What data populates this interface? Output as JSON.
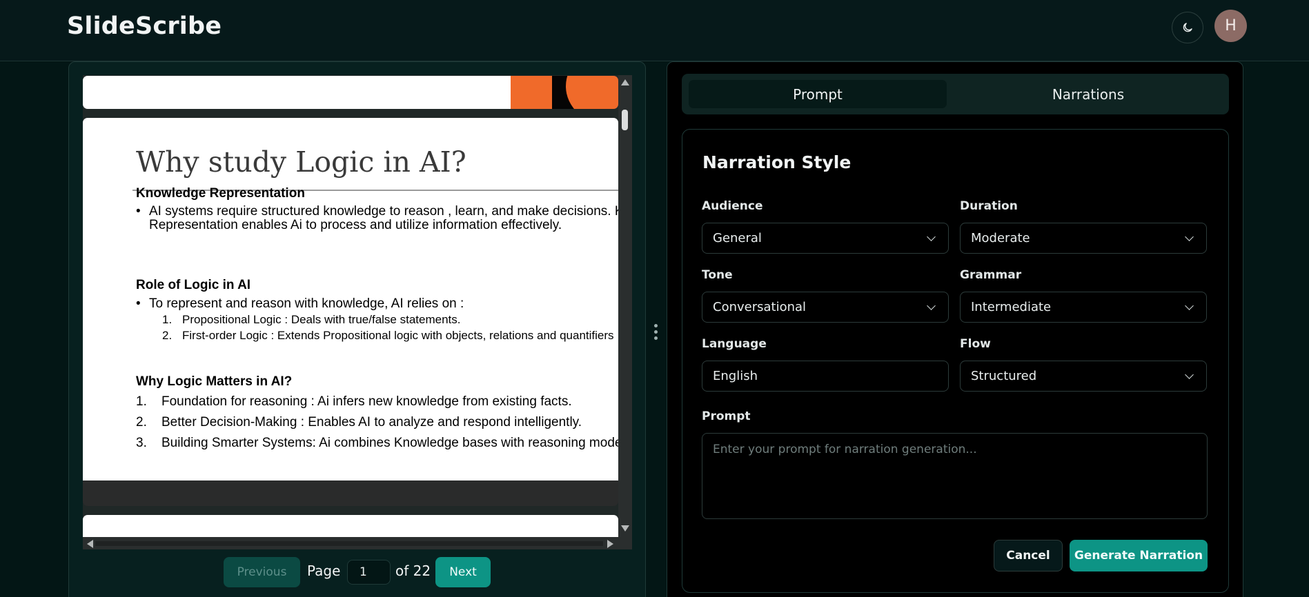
{
  "header": {
    "brand": "SlideScribe",
    "theme_icon": "moon-icon",
    "avatar_initial": "H"
  },
  "slide": {
    "title": "Why study Logic in AI?",
    "section1": {
      "heading": "Knowledge Representation",
      "bullet_line1": "AI systems require structured knowledge to reason , learn, and make decisions. K",
      "bullet_line2": "Representation enables Ai to process and utilize information effectively."
    },
    "section2": {
      "heading": "Role of Logic in AI",
      "bullet": "To represent and reason with knowledge, AI relies on :",
      "sub_items": [
        {
          "num": "1.",
          "text": "Propositional Logic : Deals with true/false statements."
        },
        {
          "num": "2.",
          "text": "First-order Logic : Extends Propositional logic with objects, relations and quantifiers"
        }
      ]
    },
    "section3": {
      "heading": "Why Logic Matters in AI?",
      "items": [
        {
          "num": "1.",
          "text": "Foundation for reasoning : Ai infers new knowledge from existing facts."
        },
        {
          "num": "2.",
          "text": "Better Decision-Making : Enables AI to analyze and respond intelligently."
        },
        {
          "num": "3.",
          "text": "Building Smarter Systems: Ai combines Knowledge bases with reasoning mode"
        }
      ]
    }
  },
  "pager": {
    "previous_label": "Previous",
    "page_label": "Page",
    "page_value": "1",
    "of_label": "of 22",
    "next_label": "Next"
  },
  "tabs": {
    "prompt": "Prompt",
    "narrations": "Narrations",
    "active": "Prompt"
  },
  "form": {
    "title": "Narration Style",
    "audience": {
      "label": "Audience",
      "value": "General"
    },
    "duration": {
      "label": "Duration",
      "value": "Moderate"
    },
    "tone": {
      "label": "Tone",
      "value": "Conversational"
    },
    "grammar": {
      "label": "Grammar",
      "value": "Intermediate"
    },
    "language": {
      "label": "Language",
      "value": "English"
    },
    "flow": {
      "label": "Flow",
      "value": "Structured"
    },
    "prompt": {
      "label": "Prompt",
      "placeholder": "Enter your prompt for narration generation..."
    },
    "cancel_label": "Cancel",
    "generate_label": "Generate Narration"
  },
  "colors": {
    "accent": "#0d9485",
    "background": "#031615",
    "slide_orange": "#f06a2a"
  }
}
